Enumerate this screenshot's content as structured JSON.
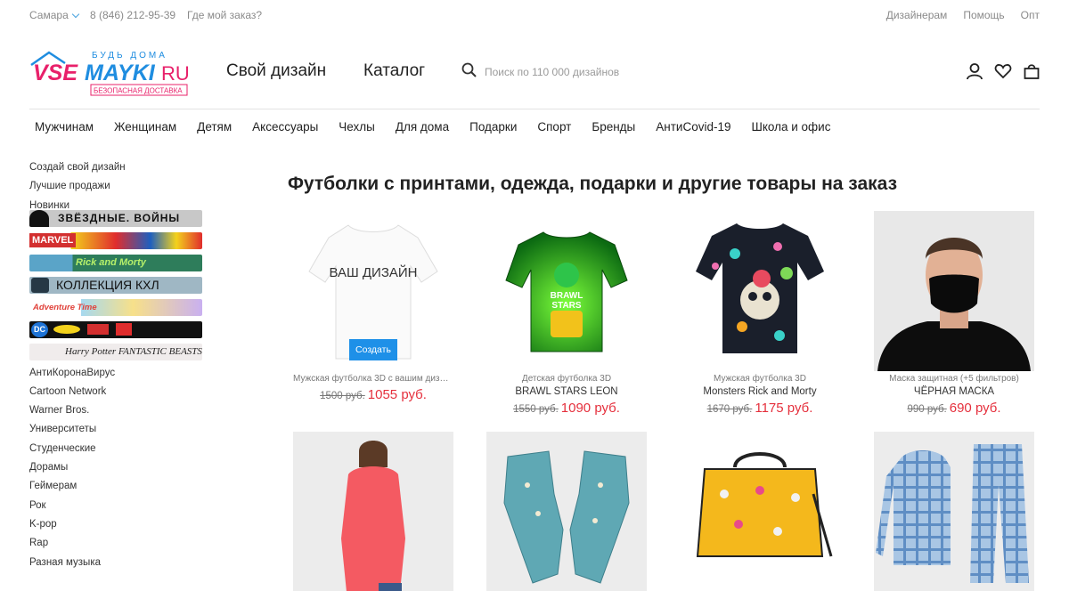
{
  "topbar": {
    "city": "Самара",
    "phone": "8 (846) 212-95-39",
    "order_link": "Где мой заказ?",
    "right_links": [
      "Дизайнерам",
      "Помощь",
      "Опт"
    ]
  },
  "logo": {
    "top_text": "БУДЬ ДОМА",
    "brand_left": "VSE",
    "brand_right": "MAYKI",
    "tld": "RU",
    "tagline": "БЕЗОПАСНАЯ ДОСТАВКА"
  },
  "header": {
    "nav": [
      "Свой дизайн",
      "Каталог"
    ],
    "search_placeholder": "Поиск по 110 000 дизайнов",
    "icons": [
      "user-icon",
      "heart-icon",
      "bag-icon"
    ]
  },
  "catnav": [
    "Мужчинам",
    "Женщинам",
    "Детям",
    "Аксессуары",
    "Чехлы",
    "Для дома",
    "Подарки",
    "Спорт",
    "Бренды",
    "АнтиCovid-19",
    "Школа и офис"
  ],
  "sidebar": {
    "top_links": [
      "Создай свой дизайн",
      "Лучшие продажи",
      "Новинки"
    ],
    "banners": [
      {
        "label": "ЗВЁЗДНЫЕ. ВОЙНЫ",
        "bg": "#c8c8c8",
        "color": "#111"
      },
      {
        "label": "MARVEL",
        "bg": "#d32f2f",
        "color": "#fff"
      },
      {
        "label": "Rick and Morty",
        "bg": "#2e7d5b",
        "color": "#b6f06a"
      },
      {
        "label": "КОЛЛЕКЦИЯ КХЛ",
        "bg": "#9fb7c4",
        "color": "#111"
      },
      {
        "label": "Adventure Time",
        "bg": "#a7d9ef",
        "color": "#e0413a"
      },
      {
        "label": "DC",
        "bg": "#111111",
        "color": "#fff"
      },
      {
        "label": "Harry Potter  FANTASTIC BEASTS",
        "bg": "#f0ecec",
        "color": "#222"
      }
    ],
    "links": [
      "АнтиКоронаВирус",
      "Cartoon Network",
      "Warner Bros.",
      "Университеты",
      "Студенческие",
      "Дорамы",
      "Геймерам",
      "Рок",
      "K-pop",
      "Rap",
      "Разная музыка"
    ]
  },
  "main": {
    "title": "Футболки с принтами, одежда, подарки и другие товары на заказ",
    "create_button": "Создать",
    "placeholder_text": "ВАШ ДИЗАЙН",
    "products": [
      {
        "category": "Мужская футболка 3D с вашим дизай...",
        "name": "",
        "old_price": "1500 руб.",
        "new_price": "1055 руб."
      },
      {
        "category": "Детская футболка 3D",
        "name": "BRAWL STARS LEON",
        "old_price": "1550 руб.",
        "new_price": "1090 руб."
      },
      {
        "category": "Мужская футболка 3D",
        "name": "Monsters Rick and Morty",
        "old_price": "1670 руб.",
        "new_price": "1175 руб."
      },
      {
        "category": "Маска защитная (+5 фильтров)",
        "name": "ЧЁРНАЯ МАСКА",
        "old_price": "990 руб.",
        "new_price": "690 руб."
      }
    ],
    "brawl_text": "BRAWL STARS"
  },
  "colors": {
    "accent": "#1e90e8",
    "price": "#e5303d",
    "brand_blue": "#1f8de0",
    "brand_pink": "#e8206a"
  }
}
